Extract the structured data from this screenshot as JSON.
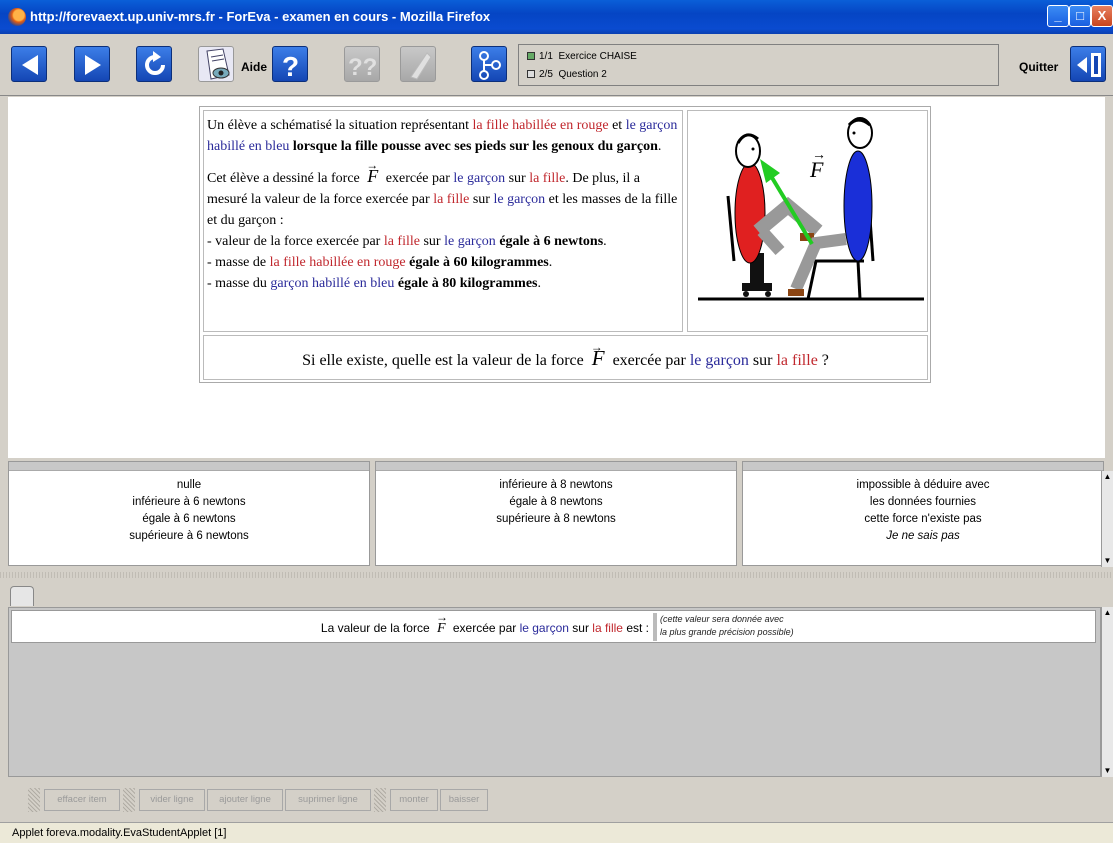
{
  "window": {
    "title": "http://forevaext.up.univ-mrs.fr - ForEva - examen en cours - Mozilla Firefox",
    "buttons": {
      "minimize": "_",
      "maximize": "□",
      "close": "X"
    }
  },
  "toolbar": {
    "help_label": "Aide",
    "quit_label": "Quitter",
    "nav": [
      {
        "counter": "1/1",
        "label": "Exercice CHAISE"
      },
      {
        "counter": "2/5",
        "label": "Question 2"
      }
    ]
  },
  "question": {
    "p1": {
      "t1": "Un élève a schématisé la situation représentant ",
      "girl_red": "la fille habillée en rouge",
      "t2": " et ",
      "boy_blue": "le garçon habillé en bleu",
      "t3": " ",
      "bold": "lorsque la fille pousse avec ses pieds sur les genoux du garçon",
      "t4": "."
    },
    "p2": {
      "t1": "Cet élève a dessiné la force ",
      "force": "F",
      "t2": " exercée par ",
      "boy": "le garçon",
      "t3": " sur ",
      "girl": "la fille",
      "t4": ". De plus, il a mesuré la valeur de la force exercée par ",
      "girl2": "la fille",
      "t5": " sur ",
      "boy2": "le garçon",
      "t6": " et les masses de la fille et du garçon :"
    },
    "l1": {
      "t1": "- valeur de la force exercée par ",
      "girl": "la fille",
      "t2": " sur ",
      "boy": "le garçon",
      "bold": " égale à 6 newtons",
      "t3": "."
    },
    "l2": {
      "t1": "- masse de ",
      "girl": "la fille habillée en rouge",
      "bold": " égale à 60 kilogrammes",
      "t3": "."
    },
    "l3": {
      "t1": "- masse du ",
      "boy": "garçon habillé en bleu",
      "bold": " égale à 80 kilogrammes",
      "t3": "."
    },
    "figure_force_label": "F",
    "bottom": {
      "t1": "Si elle existe, quelle est la valeur de la force ",
      "force": "F",
      "t2": " exercée par ",
      "boy": "le garçon",
      "t3": " sur ",
      "girl": "la fille",
      "t4": " ?"
    }
  },
  "answers": {
    "col1": [
      "nulle",
      "inférieure à 6 newtons",
      "égale à 6 newtons",
      "supérieure à 6 newtons"
    ],
    "col2": [
      "inférieure à 8 newtons",
      "égale à 8 newtons",
      "supérieure à 8 newtons"
    ],
    "col3": [
      "impossible à déduire avec",
      "les données fournies",
      "cette force n'existe pas",
      "Je ne sais pas"
    ]
  },
  "answer_line": {
    "t1": "La valeur de la force ",
    "force": "F",
    "t2": " exercée par ",
    "boy": "le garçon",
    "t3": " sur ",
    "girl": "la fille",
    "t4": " est :",
    "input_line1": "(cette valeur sera donnée avec",
    "input_line2": "la plus grande précision possible)"
  },
  "edit_buttons": [
    "effacer item",
    "vider ligne",
    "ajouter ligne",
    "suprimer ligne",
    "monter",
    "baisser"
  ],
  "status_bar": "Applet foreva.modality.EvaStudentApplet [1]",
  "colors": {
    "girl_red": "#c0272d",
    "boy_blue": "#2a2a9a",
    "arrow_green": "#22cc22",
    "titlebar_blue": "#0a4bd0"
  }
}
